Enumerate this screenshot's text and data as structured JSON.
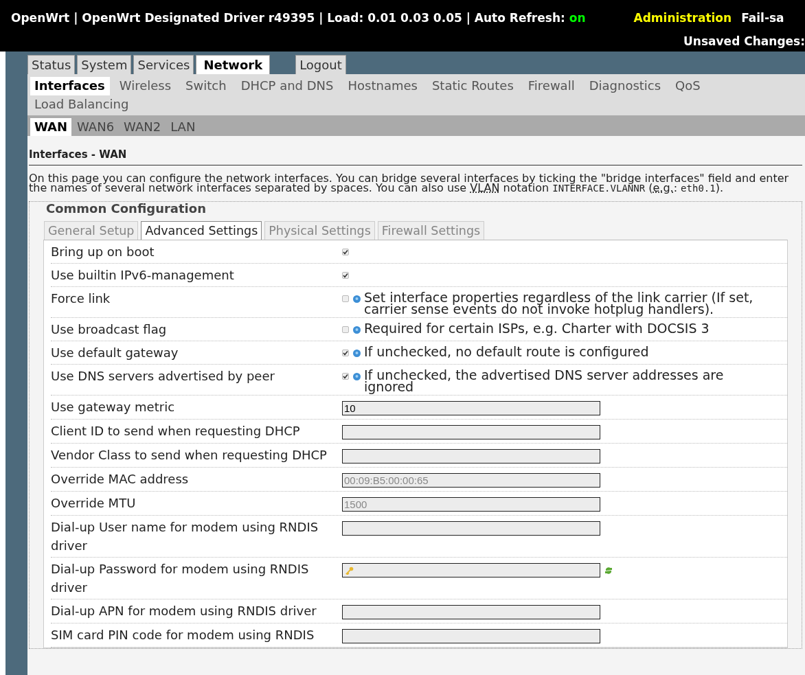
{
  "header": {
    "title": "OpenWrt | OpenWrt Designated Driver r49395 | Load: 0.01 0.03 0.05 | Auto Refresh:",
    "auto_refresh": "on",
    "admin": "Administration",
    "failsafe": "Fail-sa",
    "unsaved": "Unsaved Changes:"
  },
  "main_tabs": [
    {
      "label": "Status",
      "selected": false
    },
    {
      "label": "System",
      "selected": false
    },
    {
      "label": "Services",
      "selected": false
    },
    {
      "label": "Network",
      "selected": true
    }
  ],
  "logout": "Logout",
  "sub_tabs": [
    {
      "label": "Interfaces",
      "selected": true
    },
    {
      "label": "Wireless",
      "selected": false
    },
    {
      "label": "Switch",
      "selected": false
    },
    {
      "label": "DHCP and DNS",
      "selected": false
    },
    {
      "label": "Hostnames",
      "selected": false
    },
    {
      "label": "Static Routes",
      "selected": false
    },
    {
      "label": "Firewall",
      "selected": false
    },
    {
      "label": "Diagnostics",
      "selected": false
    },
    {
      "label": "QoS",
      "selected": false
    },
    {
      "label": "Load Balancing",
      "selected": false
    }
  ],
  "interface_tabs": [
    {
      "label": "WAN",
      "selected": true
    },
    {
      "label": "WAN6",
      "selected": false
    },
    {
      "label": "WAN2",
      "selected": false
    },
    {
      "label": "LAN",
      "selected": false
    }
  ],
  "section_title": "Interfaces - WAN",
  "description": [
    {
      "kind": "text",
      "text": "On this page you can configure the network interfaces. You can bridge several interfaces by ticking the \"bridge interfaces\" field and enter the names of several network interfaces separated by spaces. You can also use "
    },
    {
      "kind": "abbr",
      "text": "VLAN"
    },
    {
      "kind": "text",
      "text": " notation "
    },
    {
      "kind": "code",
      "text": "INTERFACE.VLANNR"
    },
    {
      "kind": "text",
      "text": " ("
    },
    {
      "kind": "abbr",
      "text": "e.g."
    },
    {
      "kind": "text",
      "text": ": "
    },
    {
      "kind": "code",
      "text": "eth0.1"
    },
    {
      "kind": "text",
      "text": ")."
    }
  ],
  "legend": "Common Configuration",
  "config_tabs": [
    {
      "label": "General Setup",
      "selected": false
    },
    {
      "label": "Advanced Settings",
      "selected": true
    },
    {
      "label": "Physical Settings",
      "selected": false
    },
    {
      "label": "Firewall Settings",
      "selected": false
    }
  ],
  "rows": [
    {
      "kind": "checkbox",
      "label": "Bring up on boot",
      "checked": true
    },
    {
      "kind": "checkbox",
      "label": "Use builtin IPv6-management",
      "checked": true
    },
    {
      "kind": "checkbox",
      "label": "Force link",
      "checked": false,
      "hint": "Set interface properties regardless of the link carrier (If set, carrier sense events do not invoke hotplug handlers)."
    },
    {
      "kind": "checkbox",
      "label": "Use broadcast flag",
      "checked": false,
      "hint": "Required for certain ISPs, e.g. Charter with DOCSIS 3"
    },
    {
      "kind": "checkbox",
      "label": "Use default gateway",
      "checked": true,
      "hint": "If unchecked, no default route is configured"
    },
    {
      "kind": "checkbox",
      "label": "Use DNS servers advertised by peer",
      "checked": true,
      "hint": "If unchecked, the advertised DNS server addresses are ignored"
    },
    {
      "kind": "text",
      "label": "Use gateway metric",
      "value": "10"
    },
    {
      "kind": "text",
      "label": "Client ID to send when requesting DHCP"
    },
    {
      "kind": "text",
      "label": "Vendor Class to send when requesting DHCP"
    },
    {
      "kind": "text",
      "label": "Override MAC address",
      "placeholder": "00:09:B5:00:00:65"
    },
    {
      "kind": "text",
      "label": "Override MTU",
      "placeholder": "1500"
    },
    {
      "kind": "text",
      "label": "Dial-up User name for modem using RNDIS driver"
    },
    {
      "kind": "password",
      "label": "Dial-up Password for modem using RNDIS driver"
    },
    {
      "kind": "text",
      "label": "Dial-up APN for modem using RNDIS driver"
    },
    {
      "kind": "text",
      "label": "SIM card PIN code for modem using RNDIS"
    }
  ]
}
